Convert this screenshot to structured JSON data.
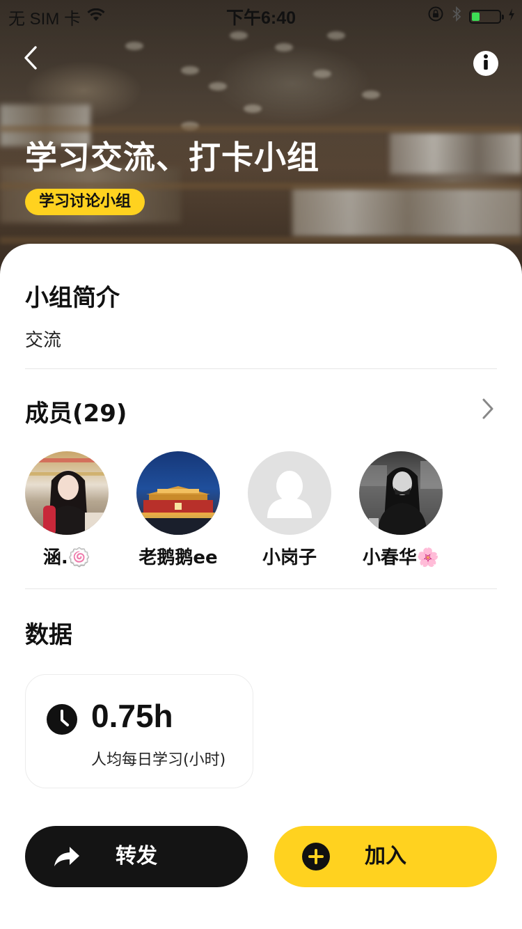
{
  "status_bar": {
    "carrier": "无 SIM 卡",
    "time": "下午6:40",
    "battery_level": 0.3,
    "battery_color": "#3ddc55"
  },
  "header": {
    "back_icon": "chevron-left-icon",
    "info_icon": "info-icon",
    "title": "学习交流、打卡小组",
    "tag": "学习讨论小组",
    "accent_color": "#ffd21f"
  },
  "intro": {
    "heading": "小组简介",
    "text": "交流"
  },
  "members": {
    "heading": "成员(29)",
    "chevron_icon": "chevron-right-icon",
    "list": [
      {
        "name": "涵.🍥",
        "avatar": "photo-girl-store"
      },
      {
        "name": "老鹅鹅ee",
        "avatar": "photo-tiananmen-night"
      },
      {
        "name": "小岗子",
        "avatar": "default-person-icon"
      },
      {
        "name": "小春华🌸",
        "avatar": "photo-girl-bw"
      }
    ]
  },
  "stats": {
    "heading": "数据",
    "clock_icon": "clock-icon",
    "value": "0.75h",
    "label": "人均每日学习(小时)"
  },
  "actions": {
    "share_label": "转发",
    "share_icon": "share-arrow-icon",
    "join_label": "加入",
    "join_icon": "plus-circle-icon"
  }
}
